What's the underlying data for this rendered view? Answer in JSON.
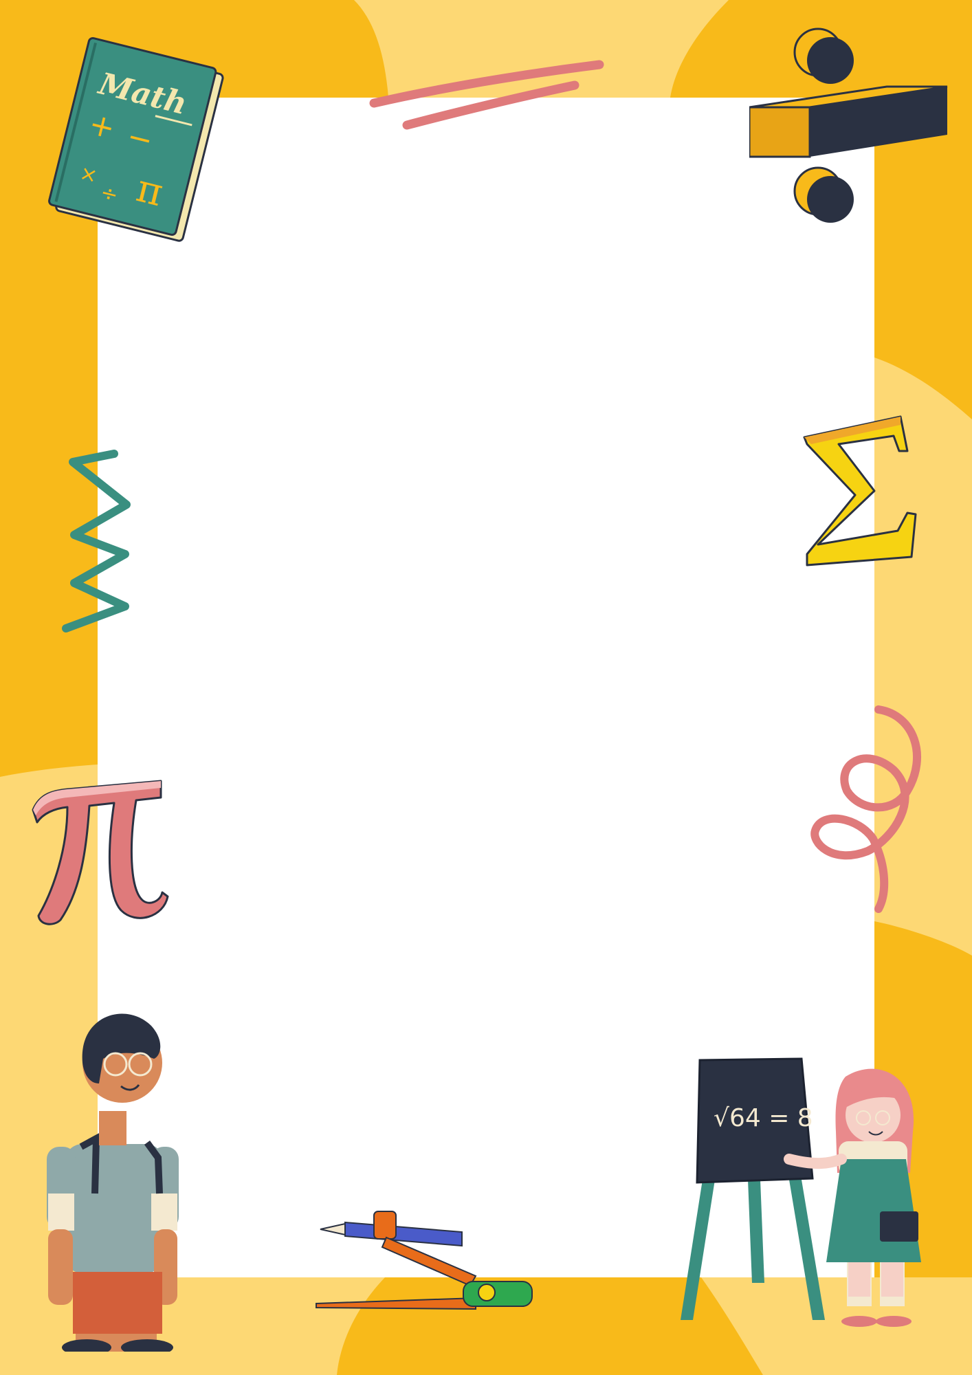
{
  "colors": {
    "background_dark": "#F8BA1A",
    "background_light": "#FDD874",
    "paper": "#FFFFFF",
    "teal": "#3A8F80",
    "pink": "#DF7A7B",
    "navy": "#2A3142",
    "yellow": "#F6D312"
  },
  "book": {
    "title": "Math"
  },
  "blackboard": {
    "equation": "√64 = 8"
  },
  "decorations": [
    "math-book-icon",
    "division-sign-icon",
    "sigma-icon",
    "pi-icon",
    "pink-double-stroke",
    "teal-zigzag",
    "pink-spiral",
    "compass-pencil-icon",
    "boy-with-backpack",
    "girl-at-blackboard"
  ]
}
